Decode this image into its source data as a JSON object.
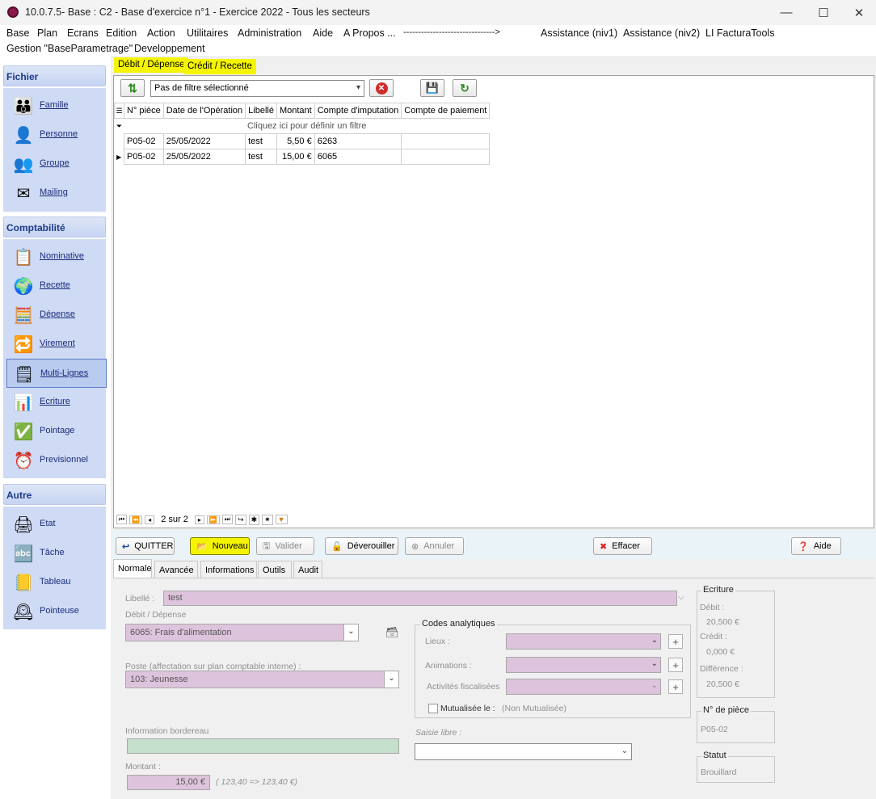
{
  "window": {
    "title": "10.0.7.5- Base : C2 - Base d'exercice n°1 - Exercice 2022 - Tous les secteurs",
    "minimize": "—",
    "maximize": "☐",
    "close": "✕"
  },
  "menu": {
    "row1": [
      "Base",
      "Plan",
      "Ecrans",
      "Edition",
      "Action",
      "Utilitaires",
      "Administration",
      "Aide",
      "A Propos ...",
      "------------------------------->",
      "Assistance (niv1)",
      "Assistance (niv2)",
      "LI FacturaTools"
    ],
    "row2": [
      "Gestion \"BaseParametrage\"",
      "Developpement"
    ]
  },
  "sidebar": {
    "groups": [
      {
        "title": "Fichier",
        "items": [
          "Famille",
          "Personne",
          "Groupe",
          "Mailing"
        ]
      },
      {
        "title": "Comptabilité",
        "items": [
          "Nominative",
          "Recette",
          "Dépense",
          "Virement",
          "Multi-Lignes",
          "Ecriture",
          "Pointage",
          "Previsionnel"
        ]
      },
      {
        "title": "Autre",
        "items": [
          "Etat",
          "Tâche",
          "Tableau",
          "Pointeuse"
        ]
      }
    ]
  },
  "tabs": {
    "debit": "Débit / Dépense",
    "credit": "Crédit / Recette"
  },
  "filter": {
    "value": "Pas de filtre sélectionné"
  },
  "grid": {
    "columns": [
      "N° pièce",
      "Date de l'Opération",
      "Libellé",
      "Montant",
      "Compte d'imputation",
      "Compte de paiement"
    ],
    "filter_hint": "Cliquez ici pour définir un filtre",
    "rows": [
      {
        "piece": "P05-02",
        "date": "25/05/2022",
        "libelle": "test",
        "montant": "5,50 €",
        "compte": "6263",
        "paiement": ""
      },
      {
        "piece": "P05-02",
        "date": "25/05/2022",
        "libelle": "test",
        "montant": "15,00 €",
        "compte": "6065",
        "paiement": ""
      }
    ],
    "pager": "2 sur 2"
  },
  "actions": {
    "quitter": "QUITTER",
    "nouveau": "Nouveau",
    "valider": "Valider",
    "deverouiller": "Déverouiller",
    "annuler": "Annuler",
    "effacer": "Effacer",
    "aide": "Aide"
  },
  "form_tabs": [
    "Normale",
    "Avancée",
    "Informations",
    "Outils",
    "Audit"
  ],
  "form": {
    "libelle_label": "Libellé :",
    "libelle_value": "test",
    "debit_label": "Débit / Dépense",
    "debit_value": "6065: Frais d'alimentation",
    "poste_label": "Poste (affectation sur plan comptable interne) :",
    "poste_value": "103: Jeunesse",
    "info_label": "Information bordereau",
    "montant_label": "Montant :",
    "montant_value": "15,00 €",
    "montant_note": "( 123,40 => 123,40 €)",
    "codes_title": "Codes analytiques",
    "lieux_label": "Lieux :",
    "animations_label": "Animations :",
    "activites_label": "Activités fiscalisées",
    "mutualisee_label": "Mutualisée le :",
    "mutualisee_value": "(Non Mutualisée)",
    "saisie_label": "Saisie libre :",
    "plus": "+"
  },
  "ecriture": {
    "title": "Ecriture",
    "debit_label": "Débit :",
    "debit_value": "20,500 €",
    "credit_label": "Crédit :",
    "credit_value": "0,000 €",
    "diff_label": "Différence :",
    "diff_value": "20,500 €"
  },
  "piece": {
    "title": "N° de pièce",
    "value": "P05-02"
  },
  "statut": {
    "title": "Statut",
    "value": "Brouillard"
  },
  "colors": {
    "highlight": "#f5f500",
    "field_pink": "#dec3dc",
    "field_green": "#c4dfcc",
    "sidebar_blue": "#cfdaf4"
  }
}
